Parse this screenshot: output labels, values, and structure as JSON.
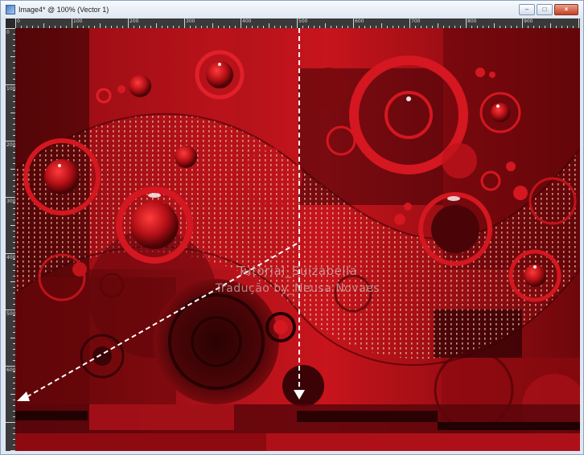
{
  "window": {
    "title": "Image4* @ 100% (Vector 1)",
    "buttons": {
      "minimize": "–",
      "maximize": "□",
      "close": "×"
    }
  },
  "ruler": {
    "top_labels": [
      "0",
      "100",
      "200",
      "300",
      "400",
      "500",
      "600",
      "700",
      "800",
      "900"
    ],
    "left_labels": [
      "0",
      "100",
      "200",
      "300",
      "400",
      "500",
      "600"
    ]
  },
  "canvas": {
    "watermark_line1": "Tutorial_Suizabella",
    "watermark_line2": "Tradução by_Neusa Novaes"
  },
  "colors": {
    "window_frame": "#dfe7f2",
    "ruler": "#3a3a3a",
    "canvas_base": "#8b0a0d",
    "arrow": "#ffffff"
  }
}
